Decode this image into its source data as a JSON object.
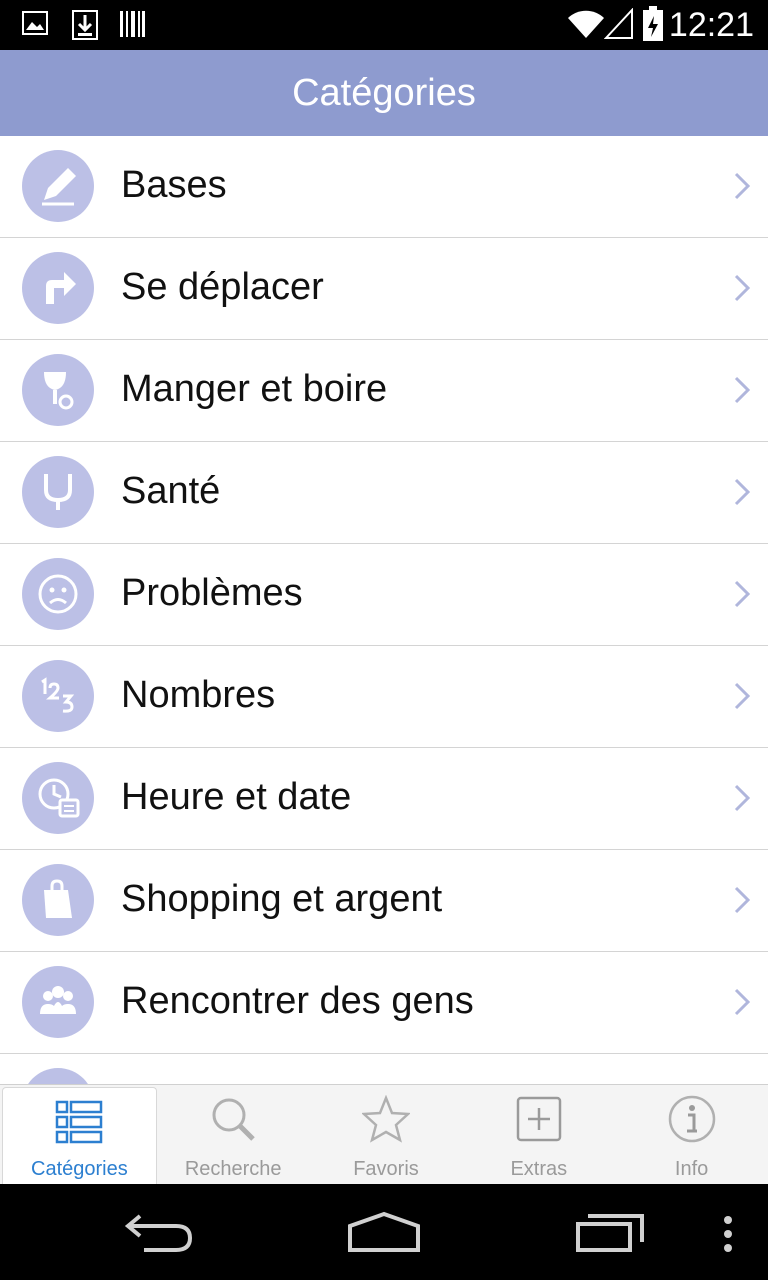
{
  "status_bar": {
    "time": "12:21",
    "icons": [
      "image-notification-icon",
      "download-notification-icon",
      "barcode-notification-icon",
      "wifi-icon",
      "signal-icon",
      "battery-icon"
    ]
  },
  "header": {
    "title": "Catégories"
  },
  "categories": [
    {
      "label": "Bases",
      "icon": "pencil-icon"
    },
    {
      "label": "Se déplacer",
      "icon": "turn-right-arrow-icon"
    },
    {
      "label": "Manger et boire",
      "icon": "glass-icon"
    },
    {
      "label": "Santé",
      "icon": "stethoscope-icon"
    },
    {
      "label": "Problèmes",
      "icon": "sad-face-icon"
    },
    {
      "label": "Nombres",
      "icon": "numbers-icon"
    },
    {
      "label": "Heure et date",
      "icon": "clock-calendar-icon"
    },
    {
      "label": "Shopping et argent",
      "icon": "shopping-bag-icon"
    },
    {
      "label": "Rencontrer des gens",
      "icon": "people-icon"
    },
    {
      "label": "",
      "icon": "partial-icon"
    }
  ],
  "tabs": [
    {
      "label": "Catégories",
      "icon": "list-grid-icon",
      "active": true
    },
    {
      "label": "Recherche",
      "icon": "search-icon",
      "active": false
    },
    {
      "label": "Favoris",
      "icon": "star-icon",
      "active": false
    },
    {
      "label": "Extras",
      "icon": "plus-box-icon",
      "active": false
    },
    {
      "label": "Info",
      "icon": "info-icon",
      "active": false
    }
  ],
  "colors": {
    "header_bg": "#8e9bcf",
    "icon_circle": "#bcc0e6",
    "active_tab": "#2c7fd0",
    "inactive_tab": "#9a9a9a"
  },
  "nav": {
    "buttons": [
      "back-icon",
      "home-icon",
      "recent-apps-icon",
      "overflow-menu-icon"
    ]
  }
}
